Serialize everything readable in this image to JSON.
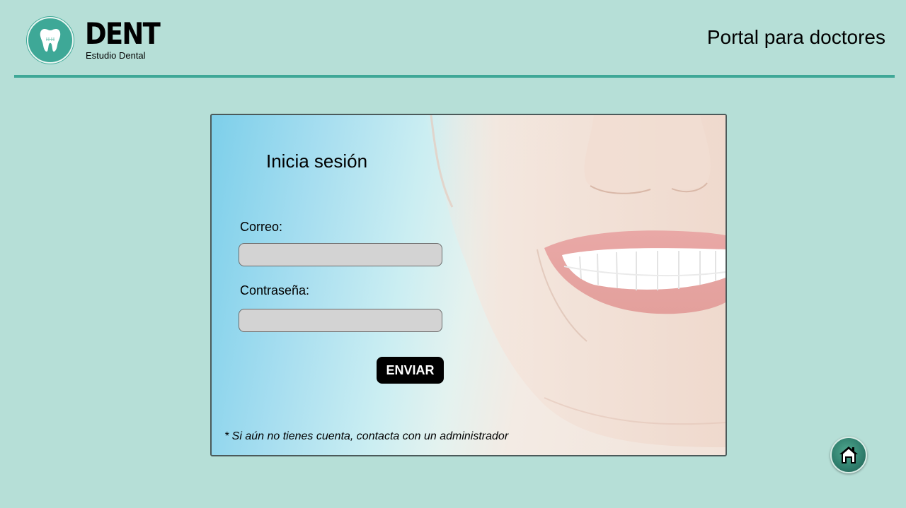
{
  "header": {
    "logo_icon": "tooth-icon",
    "brand_name": "DENT",
    "brand_subtitle": "Estudio Dental",
    "portal_title": "Portal para doctores"
  },
  "login": {
    "heading": "Inicia sesión",
    "email_label": "Correo:",
    "email_value": "",
    "password_label": "Contraseña:",
    "password_value": "",
    "submit_label": "ENVIAR",
    "footnote": "* Si aún no tienes cuenta, contacta con un administrador"
  },
  "home_button": {
    "icon": "home-icon"
  },
  "colors": {
    "background": "#b6dfd7",
    "accent": "#3ea897",
    "field": "#d3d3d3",
    "button": "#000000"
  }
}
